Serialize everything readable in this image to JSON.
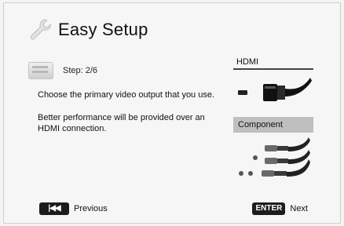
{
  "header": {
    "title": "Easy Setup",
    "icon": "wrench-icon"
  },
  "step": {
    "text": "Step: 2/6",
    "icon": "step-icon"
  },
  "instructions": "Choose the primary video output that you use.",
  "note": "Better performance will be provided over an HDMI connection.",
  "options": [
    {
      "label": "HDMI",
      "state": "underlined"
    },
    {
      "label": "Component",
      "state": "selected"
    }
  ],
  "footer": {
    "previous": {
      "key": "|◀◀",
      "label": "Previous"
    },
    "next": {
      "key": "ENTER",
      "label": "Next"
    }
  },
  "colors": {
    "background": "#f4f4f4",
    "selected": "#bfbfbf",
    "key_bg": "#1c1c1c"
  }
}
